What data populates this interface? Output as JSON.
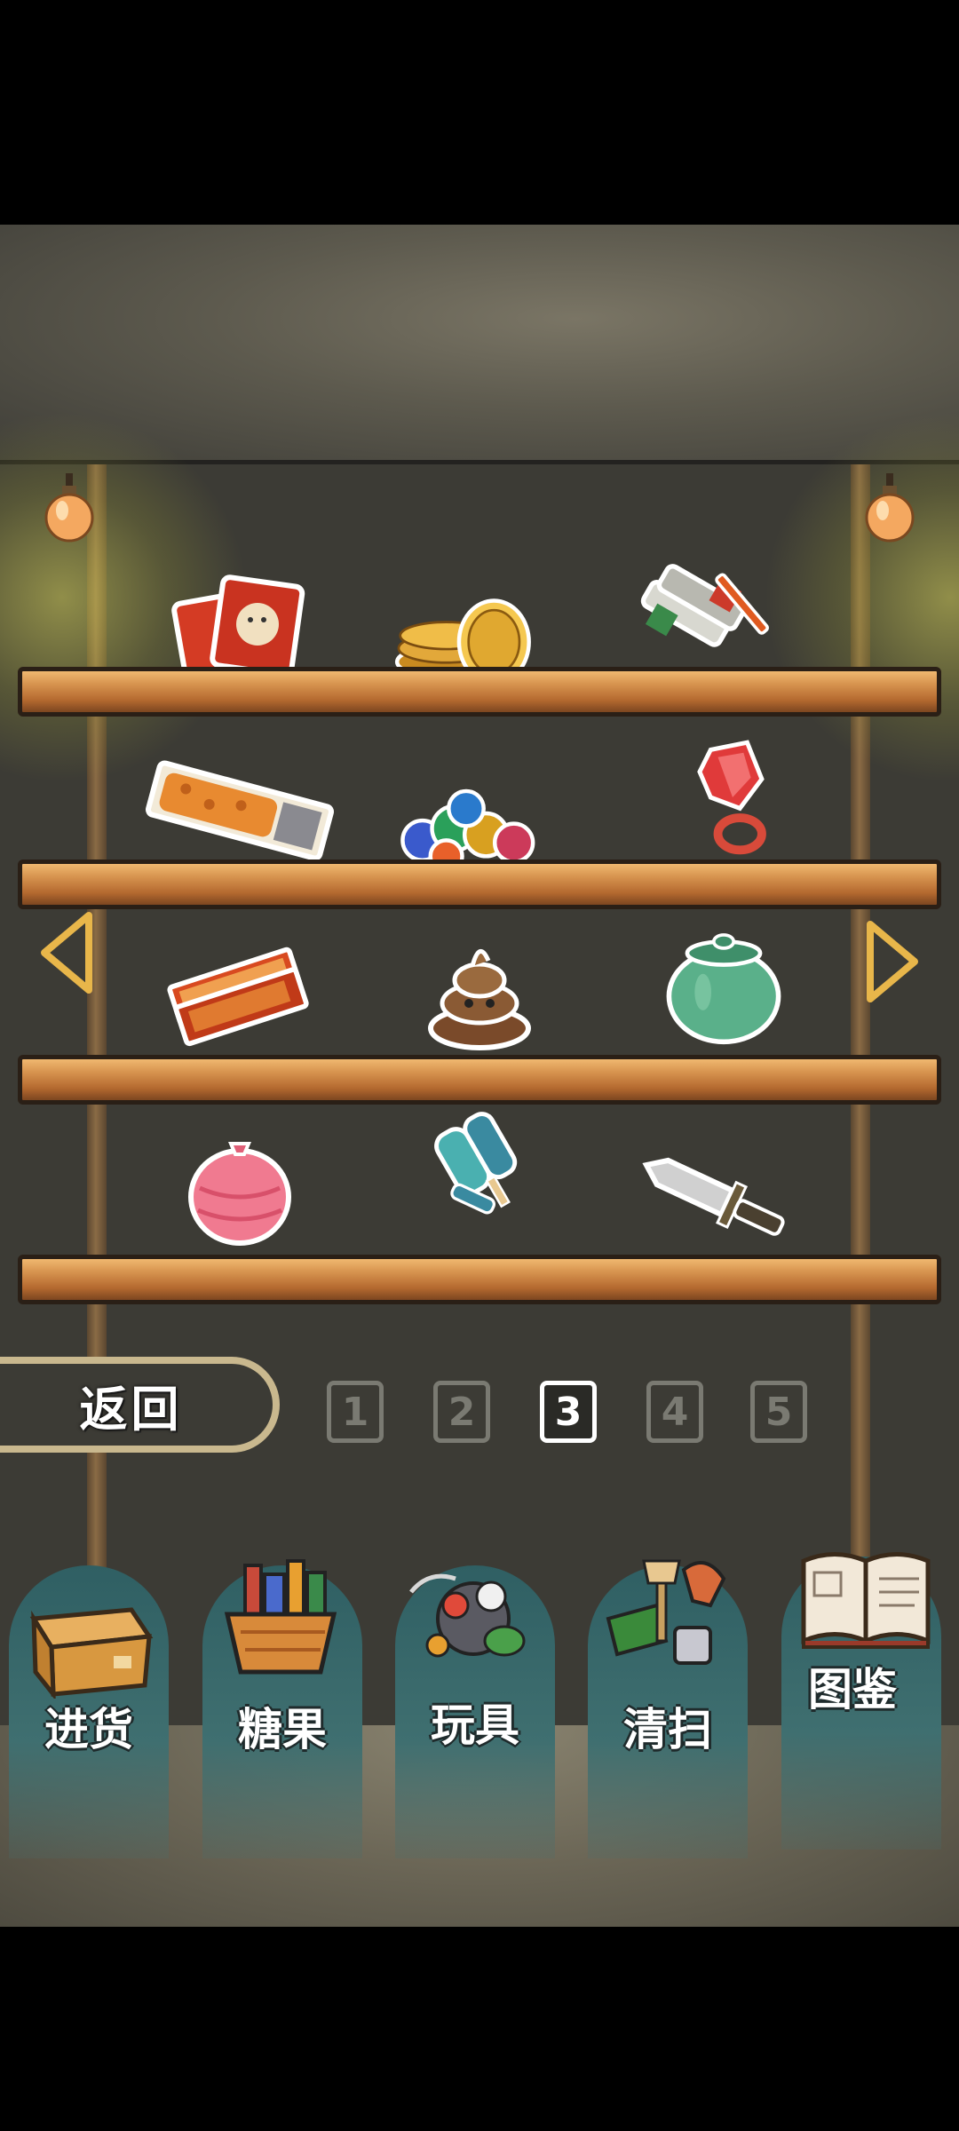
{
  "back_label": "返回",
  "pagination": {
    "pages": [
      "1",
      "2",
      "3",
      "4",
      "5"
    ],
    "current": "3"
  },
  "shelves": [
    {
      "items": [
        "card-pack-icon",
        "gold-coins-icon",
        "paint-tubes-icon"
      ]
    },
    {
      "items": [
        "snack-bar-icon",
        "marbles-icon",
        "ring-pop-icon"
      ]
    },
    {
      "items": [
        "candy-pack-icon",
        "poop-toy-icon",
        "green-jar-icon"
      ]
    },
    {
      "items": [
        "water-balloon-icon",
        "popsicle-icon",
        "toy-knife-icon"
      ]
    }
  ],
  "nav": [
    {
      "label": "进货",
      "icon": "cardboard-box-icon"
    },
    {
      "label": "糖果",
      "icon": "candy-basket-icon"
    },
    {
      "label": "玩具",
      "icon": "toy-pile-icon"
    },
    {
      "label": "清扫",
      "icon": "cleaning-tools-icon"
    },
    {
      "label": "图鉴",
      "icon": "open-book-icon"
    }
  ],
  "colors": {
    "wall": "#3c3b35",
    "shelf": "#d89550",
    "nav_tile": "#2f5f63",
    "arrow": "#e8b64a"
  }
}
